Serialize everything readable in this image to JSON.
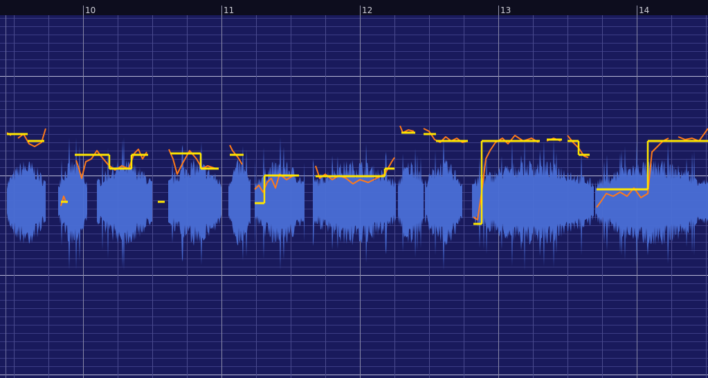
{
  "timeline": {
    "bars": [
      "10",
      "11",
      "12",
      "13",
      "14"
    ]
  },
  "colors": {
    "background": "#191a5c",
    "ruler": "#0d0d1e",
    "waveform": "#4a6fd6",
    "pitch_curve": "#ff7a1a",
    "note_blocks": "#ffe600",
    "grid_major": "#8a8aa8",
    "grid_minor": "#3c3d86"
  },
  "icons": {
    "waveform": "audio-waveform",
    "pitch": "pitch-curve",
    "notes": "note-segments"
  }
}
